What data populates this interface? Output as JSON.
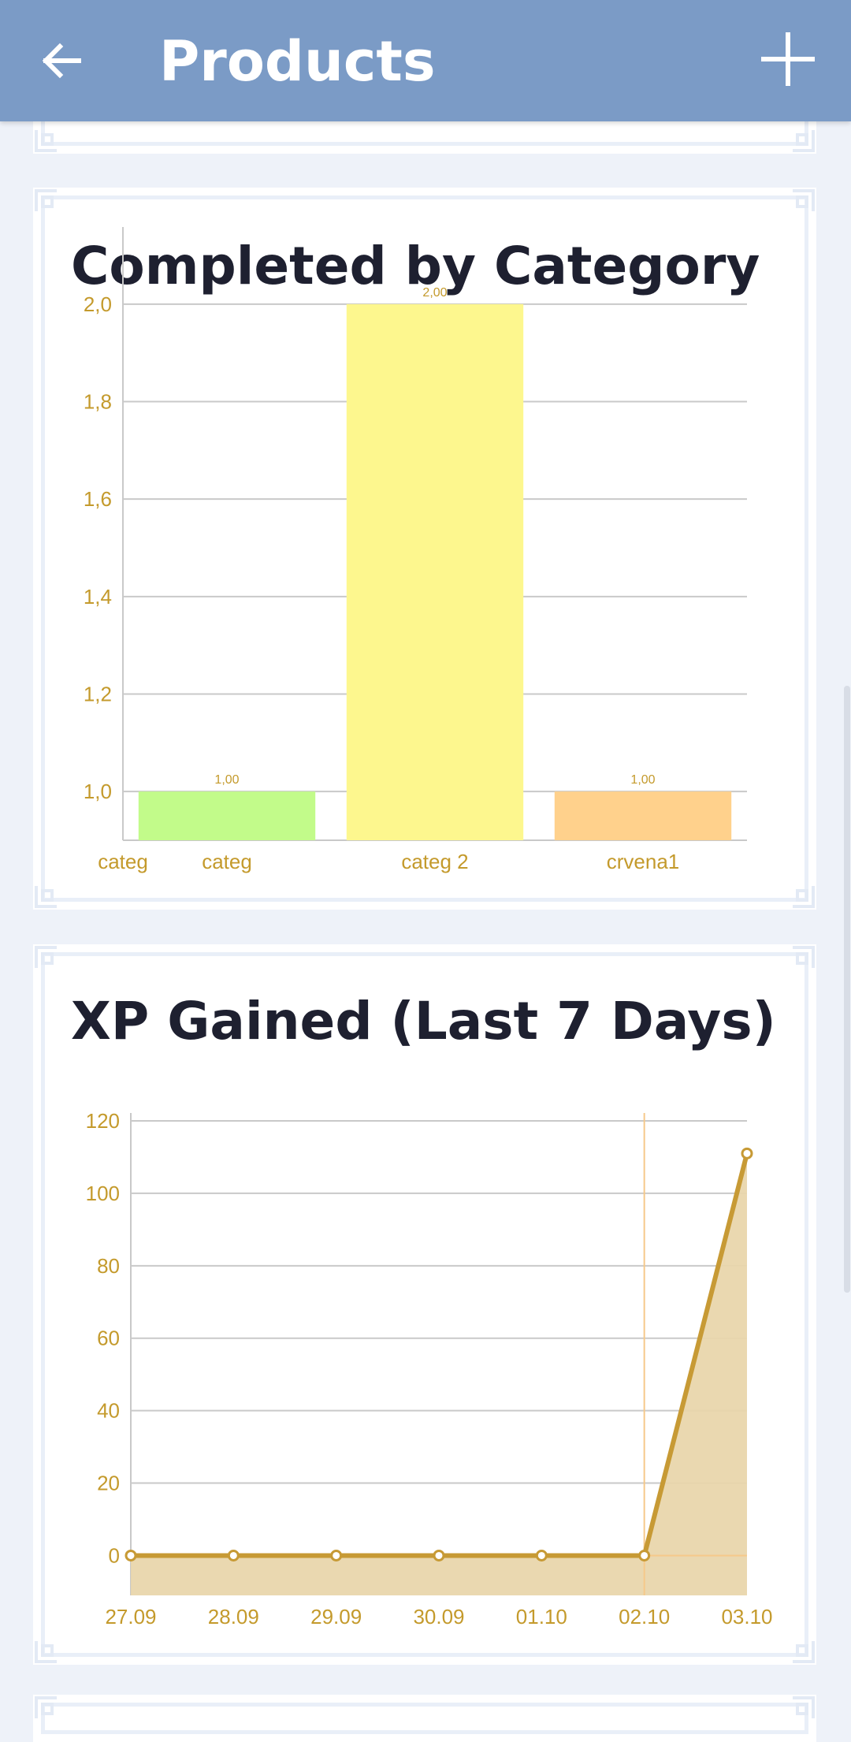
{
  "appbar": {
    "title": "Products",
    "back_icon": "arrow-left-icon",
    "add_icon": "plus-icon",
    "background_color": "#7b9bc6"
  },
  "cards": {
    "category": {
      "title": "Completed by Category"
    },
    "xp": {
      "title": "XP Gained (Last 7 Days)"
    }
  },
  "chart_data": [
    {
      "type": "bar",
      "title": "Completed by Category",
      "categories": [
        "categ",
        "categ",
        "categ 2",
        "crvena1"
      ],
      "values": [
        null,
        1.0,
        2.0,
        1.0
      ],
      "value_labels": [
        "",
        "1,00",
        "2,00",
        "1,00"
      ],
      "bar_colors": [
        "",
        "#c2fb8a",
        "#fdf78e",
        "#ffd18c"
      ],
      "y_ticks": [
        "1,0",
        "1,2",
        "1,4",
        "1,6",
        "1,8",
        "2,0"
      ],
      "ylim": [
        0.9,
        2.1
      ],
      "grid": true,
      "xlabel": "",
      "ylabel": ""
    },
    {
      "type": "area",
      "title": "XP Gained (Last 7 Days)",
      "x": [
        "27.09",
        "28.09",
        "29.09",
        "30.09",
        "01.10",
        "02.10",
        "03.10"
      ],
      "values": [
        0,
        0,
        0,
        0,
        0,
        0,
        111
      ],
      "y_ticks": [
        "0",
        "20",
        "40",
        "60",
        "80",
        "100",
        "120"
      ],
      "ylim": [
        -11,
        120
      ],
      "grid": true,
      "highlighted_x": "02.10",
      "line_color": "#c79a35",
      "fill_color": "#e9d6ac",
      "xlabel": "",
      "ylabel": ""
    }
  ]
}
